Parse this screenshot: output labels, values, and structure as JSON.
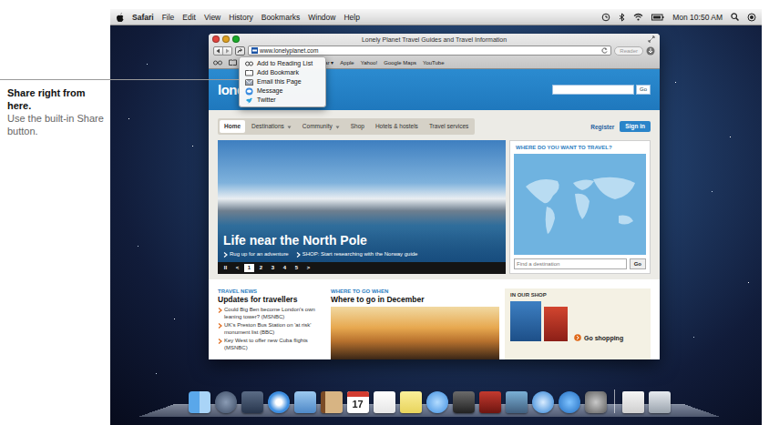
{
  "callout": {
    "title": "Share right from here.",
    "body": "Use the built-in Share button."
  },
  "menubar": {
    "app": "Safari",
    "menus": [
      "File",
      "Edit",
      "View",
      "History",
      "Bookmarks",
      "Window",
      "Help"
    ],
    "clock": "Mon 10:50 AM"
  },
  "window": {
    "title": "Lonely Planet Travel Guides and Travel Information",
    "url": "www.lonelyplanet.com",
    "reader": "Reader",
    "reader_disabled": true
  },
  "bookmarks": [
    "lar ▾",
    "Apple",
    "Yahoo!",
    "Google Maps",
    "YouTube"
  ],
  "share_menu": {
    "items": [
      "Add to Reading List",
      "Add Bookmark",
      "Email this Page",
      "Message",
      "Twitter"
    ]
  },
  "page": {
    "logo": "lonel",
    "search_button": "Go",
    "nav": [
      {
        "label": "Home",
        "selected": true,
        "dropdown": false
      },
      {
        "label": "Destinations",
        "selected": false,
        "dropdown": true
      },
      {
        "label": "Community",
        "selected": false,
        "dropdown": true
      },
      {
        "label": "Shop",
        "selected": false,
        "dropdown": false
      },
      {
        "label": "Hotels & hostels",
        "selected": false,
        "dropdown": false
      },
      {
        "label": "Travel services",
        "selected": false,
        "dropdown": false
      }
    ],
    "register": "Register",
    "sign_in": "Sign in",
    "hero": {
      "title": "Life near the North Pole",
      "links": [
        "Rug up for an adventure",
        "SHOP: Start researching with the Norway guide"
      ],
      "controls": [
        {
          "label": "II",
          "selected": false
        },
        {
          "label": "<",
          "selected": false
        },
        {
          "label": "1",
          "selected": true
        },
        {
          "label": "2",
          "selected": false
        },
        {
          "label": "3",
          "selected": false
        },
        {
          "label": "4",
          "selected": false
        },
        {
          "label": "5",
          "selected": false
        },
        {
          "label": ">",
          "selected": false
        }
      ]
    },
    "finder": {
      "title": "WHERE DO YOU WANT TO TRAVEL?",
      "placeholder": "Find a destination",
      "button": "Go"
    },
    "news": {
      "kicker": "TRAVEL NEWS",
      "title": "Updates for travellers",
      "items": [
        "Could Big Ben become London's own leaning tower? (MSNBC)",
        "UK's Preston Bus Station on 'at risk' monument list (BBC)",
        "Key West to offer new Cuba flights (MSNBC)"
      ]
    },
    "when": {
      "kicker": "WHERE TO GO WHEN",
      "title": "Where to go in December"
    },
    "shop": {
      "kicker": "IN OUR SHOP",
      "link": "Go shopping"
    }
  },
  "dock": {
    "calendar_day": "17"
  }
}
